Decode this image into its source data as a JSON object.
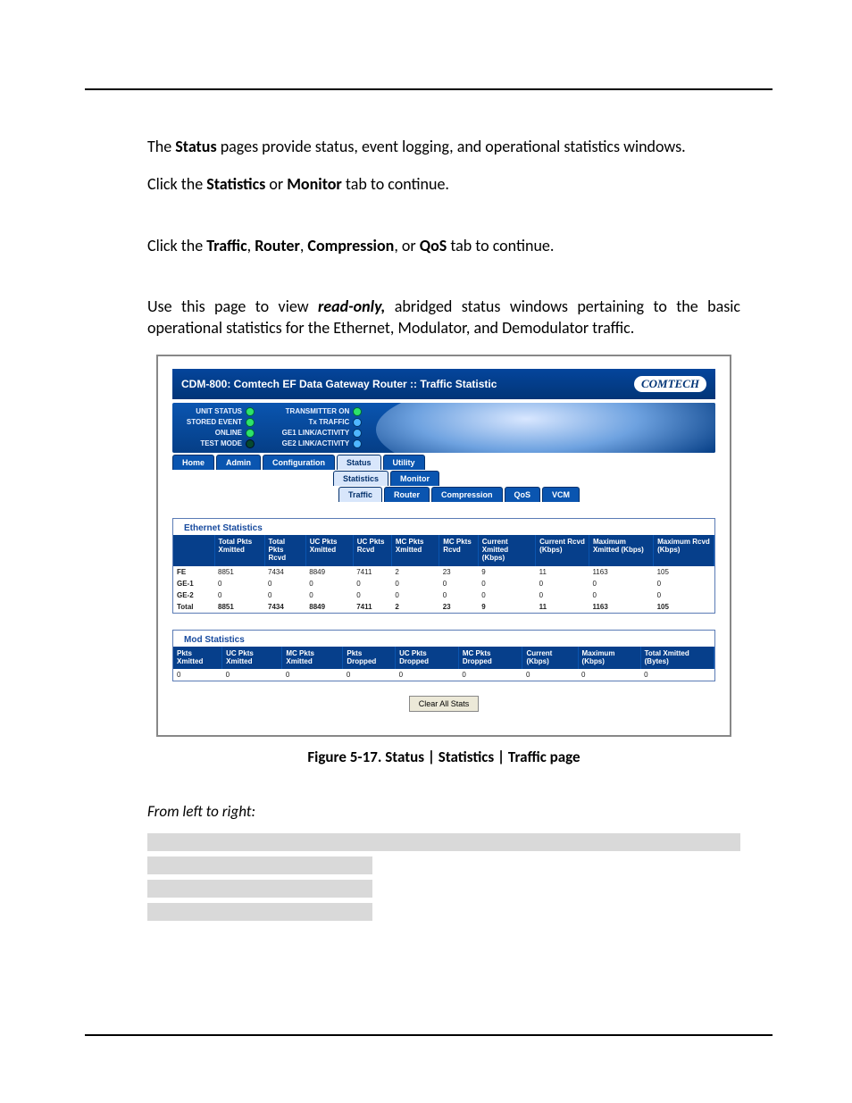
{
  "intro1_a": "The ",
  "intro1_b": "Status",
  "intro1_c": " pages provide status, event logging, and operational statistics windows.",
  "intro2_a": "Click the ",
  "intro2_b": "Statistics",
  "intro2_c": " or ",
  "intro2_d": "Monitor",
  "intro2_e": " tab to continue.",
  "intro3_a": "Click the ",
  "intro3_b": "Traffic",
  "intro3_c": ", ",
  "intro3_d": "Router",
  "intro3_e": ", ",
  "intro3_f": "Compression",
  "intro3_g": ", or ",
  "intro3_h": "QoS",
  "intro3_i": " tab to continue.",
  "intro4_a": "Use this page to view ",
  "intro4_b": "read-only,",
  "intro4_c": " abridged status windows pertaining to the basic operational statistics for the Ethernet, Modulator, and Demodulator traffic.",
  "caption": "Figure 5-17. Status | Statistics | Traffic page",
  "section_sub": "From left to right:",
  "shot": {
    "title": "CDM-800: Comtech EF Data Gateway Router :: Traffic Statistic",
    "logo": "COMTECH",
    "status_left": [
      "UNIT STATUS",
      "STORED EVENT",
      "ONLINE",
      "TEST MODE"
    ],
    "status_right": [
      "TRANSMITTER ON",
      "Tx TRAFFIC",
      "GE1 LINK/ACTIVITY",
      "GE2 LINK/ACTIVITY"
    ],
    "tabs1": [
      "Home",
      "Admin",
      "Configuration",
      "Status",
      "Utility"
    ],
    "tabs2": [
      "Statistics",
      "Monitor"
    ],
    "tabs3": [
      "Traffic",
      "Router",
      "Compression",
      "QoS",
      "VCM"
    ],
    "eth_legend": "Ethernet Statistics",
    "eth_headers": [
      "",
      "Total Pkts Xmitted",
      "Total Pkts Rcvd",
      "UC Pkts Xmitted",
      "UC Pkts Rcvd",
      "MC Pkts Xmitted",
      "MC Pkts Rcvd",
      "Current Xmitted (Kbps)",
      "Current Rcvd (Kbps)",
      "Maximum Xmitted (Kbps)",
      "Maximum Rcvd (Kbps)"
    ],
    "eth_rows": [
      [
        "FE",
        "8851",
        "7434",
        "8849",
        "7411",
        "2",
        "23",
        "9",
        "11",
        "1163",
        "105"
      ],
      [
        "GE-1",
        "0",
        "0",
        "0",
        "0",
        "0",
        "0",
        "0",
        "0",
        "0",
        "0"
      ],
      [
        "GE-2",
        "0",
        "0",
        "0",
        "0",
        "0",
        "0",
        "0",
        "0",
        "0",
        "0"
      ],
      [
        "Total",
        "8851",
        "7434",
        "8849",
        "7411",
        "2",
        "23",
        "9",
        "11",
        "1163",
        "105"
      ]
    ],
    "mod_legend": "Mod Statistics",
    "mod_headers": [
      "Pkts Xmitted",
      "UC Pkts Xmitted",
      "MC Pkts Xmitted",
      "Pkts Dropped",
      "UC Pkts Dropped",
      "MC Pkts Dropped",
      "Current (Kbps)",
      "Maximum (Kbps)",
      "Total Xmitted (Bytes)"
    ],
    "mod_row": [
      "0",
      "0",
      "0",
      "0",
      "0",
      "0",
      "0",
      "0",
      "0"
    ],
    "clear_btn": "Clear All Stats"
  }
}
